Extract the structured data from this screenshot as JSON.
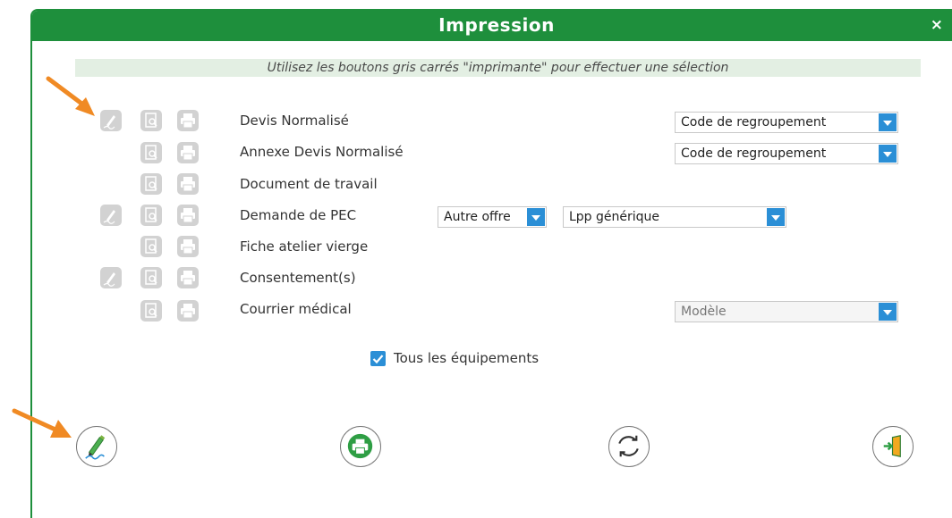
{
  "dialog": {
    "title": "Impression",
    "close_label": "×",
    "instruction": "Utilisez les boutons gris carrés \"imprimante\" pour effectuer une sélection"
  },
  "documents": [
    {
      "label": "Devis Normalisé",
      "has_sign": true,
      "select": "Code de regroupement"
    },
    {
      "label": "Annexe Devis Normalisé",
      "has_sign": false,
      "select": "Code de regroupement"
    },
    {
      "label": "Document de travail",
      "has_sign": false
    },
    {
      "label": "Demande de PEC",
      "has_sign": true,
      "select_offer": "Autre offre",
      "select_lpp": "Lpp générique"
    },
    {
      "label": "Fiche atelier vierge",
      "has_sign": false
    },
    {
      "label": "Consentement(s)",
      "has_sign": true
    },
    {
      "label": "Courrier médical",
      "has_sign": false,
      "select": "Modèle"
    }
  ],
  "all_equipment": {
    "label": "Tous les équipements",
    "checked": true
  },
  "colors": {
    "header": "#1e8f3c",
    "accent": "#2b8fd6",
    "icon_gray": "#d2d2d2",
    "annotation": "#f08a24"
  },
  "icons": [
    "pencil-sign-icon",
    "preview-icon",
    "printer-icon",
    "refresh-icon",
    "exit-door-icon"
  ]
}
